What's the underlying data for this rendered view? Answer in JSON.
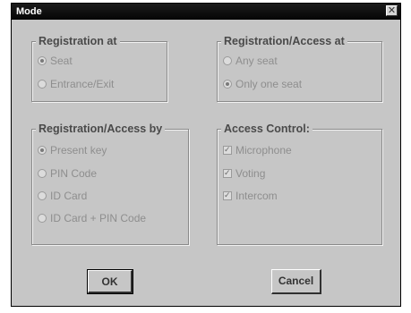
{
  "window": {
    "title": "Mode",
    "close_glyph": "✕"
  },
  "groups": {
    "registration_at": {
      "title": "Registration at",
      "options": [
        {
          "label": "Seat",
          "selected": true
        },
        {
          "label": "Entrance/Exit",
          "selected": false
        }
      ]
    },
    "registration_access_at": {
      "title": "Registration/Access at",
      "options": [
        {
          "label": "Any seat",
          "selected": false
        },
        {
          "label": "Only one seat",
          "selected": true
        }
      ]
    },
    "registration_access_by": {
      "title": "Registration/Access by",
      "options": [
        {
          "label": "Present key",
          "selected": true
        },
        {
          "label": "PIN Code",
          "selected": false
        },
        {
          "label": "ID Card",
          "selected": false
        },
        {
          "label": "ID Card + PIN Code",
          "selected": false
        }
      ]
    },
    "access_control": {
      "title": "Access Control:",
      "options": [
        {
          "label": "Microphone",
          "checked": true
        },
        {
          "label": "Voting",
          "checked": true
        },
        {
          "label": "Intercom",
          "checked": true
        }
      ]
    }
  },
  "buttons": {
    "ok": "OK",
    "cancel": "Cancel"
  }
}
